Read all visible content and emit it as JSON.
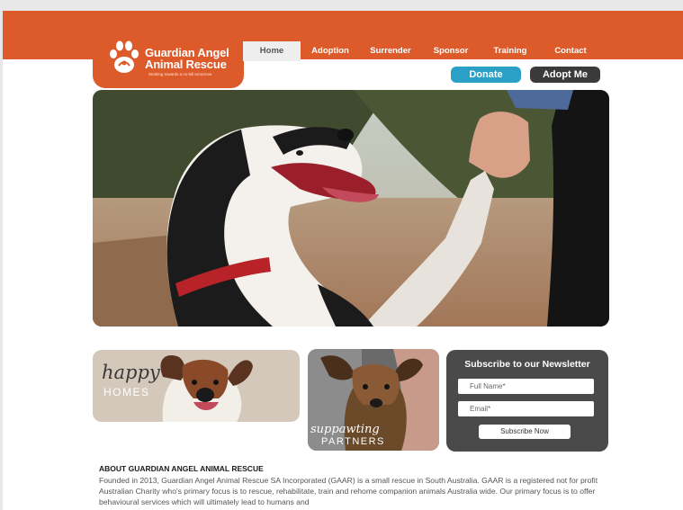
{
  "logo": {
    "line1": "Guardian Angel",
    "line2": "Animal Rescue",
    "tagline": "Working towards a no-kill tomorrow"
  },
  "nav": {
    "items": [
      {
        "label": "Home",
        "active": true
      },
      {
        "label": "Adoption"
      },
      {
        "label": "Surrender"
      },
      {
        "label": "Sponsor"
      },
      {
        "label": "Training"
      },
      {
        "label": "Contact"
      }
    ]
  },
  "actions": {
    "donate": "Donate",
    "adopt": "Adopt Me"
  },
  "cards": {
    "homes": {
      "script": "happy",
      "caps": "HOMES"
    },
    "partners": {
      "script": "suppawting",
      "caps": "PARTNERS"
    }
  },
  "newsletter": {
    "title": "Subscribe to our Newsletter",
    "name_placeholder": "Full Name*",
    "email_placeholder": "Email*",
    "button": "Subscribe Now"
  },
  "about": {
    "heading": "ABOUT GUARDIAN ANGEL ANIMAL RESCUE",
    "text": "Founded in 2013, Guardian Angel Animal Rescue SA Incorporated (GAAR) is a small rescue in South Australia. GAAR is a registered not for profit Australian Charity who's primary focus is to rescue, rehabilitate, train and rehome companion animals Australia wide. Our primary focus is to offer behavioural services which will ultimately lead to humans and"
  },
  "colors": {
    "brand": "#dd5a2b",
    "donate": "#2ba0c6",
    "adopt": "#3a3a3a",
    "newsletter_bg": "#4a4a4a"
  }
}
